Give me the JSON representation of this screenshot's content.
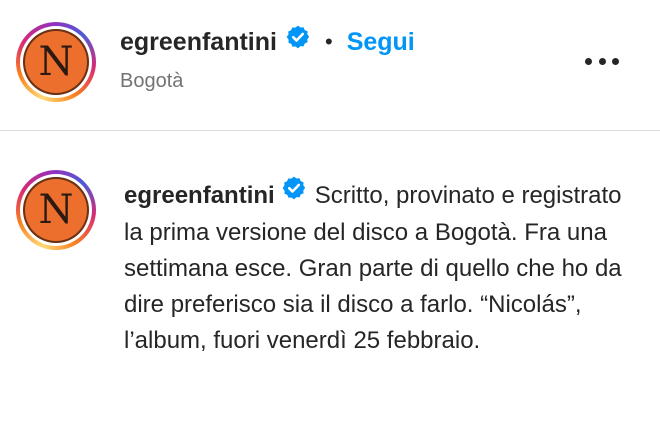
{
  "post_header": {
    "username": "egreenfantini",
    "separator": "•",
    "follow_label": "Segui",
    "location": "Bogotà",
    "avatar_letter": "N"
  },
  "caption": {
    "username": "egreenfantini",
    "avatar_letter": "N",
    "text": "Scritto, provinato e registrato la prima versione del disco a Bogotà. Fra una settimana esce. Gran parte di quello che ho da dire preferisco sia il disco a farlo. “Nicolás”, l’album, fuori venerdì 25 febbraio."
  },
  "colors": {
    "follow": "#0095f6",
    "verified_badge": "#0095f6",
    "avatar_background": "#ec6f2d",
    "secondary_text": "#737373",
    "divider": "#dbdbdb"
  },
  "icons": {
    "verified": "verified-badge-icon",
    "more": "more-options-icon"
  }
}
